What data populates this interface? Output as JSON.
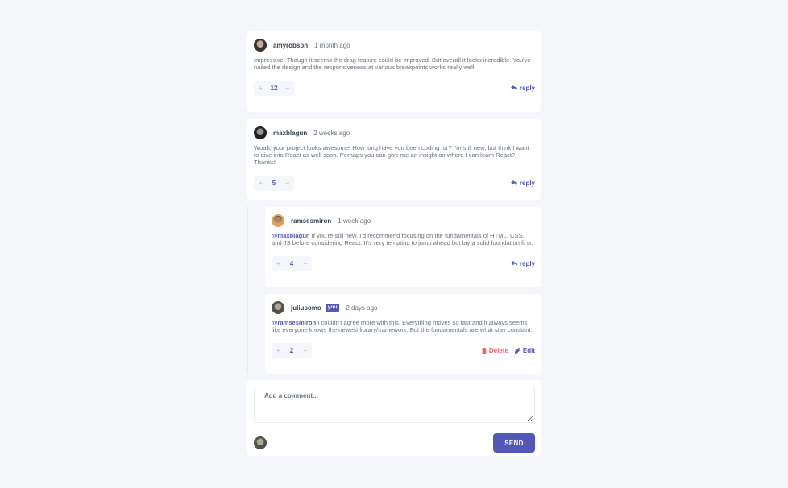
{
  "colors": {
    "primary": "#5357b6",
    "danger": "#ed6368",
    "page_bg": "#f5f6fa",
    "text_dark": "#334253",
    "text_muted": "#67727e"
  },
  "icons": {
    "reply": "reply-arrow-icon",
    "delete": "trash-icon",
    "edit": "pencil-icon",
    "upvote": "plus-icon",
    "downvote": "minus-icon"
  },
  "comments": [
    {
      "username": "amyrobson",
      "date": "1 month ago",
      "mention": "",
      "content": "Impressive! Though it seems the drag feature could be improved. But overall it looks incredible. You've nailed the design and the responsiveness at various breakpoints works really well.",
      "score": "12",
      "reply_label": "reply"
    },
    {
      "username": "maxblagun",
      "date": "2 weeks ago",
      "mention": "",
      "content": "Woah, your project looks awesome! How long have you been coding for? I'm still new, but think I want to dive into React as well soon. Perhaps you can give me an insight on where I can learn React? Thanks!",
      "score": "5",
      "reply_label": "reply",
      "replies": [
        {
          "username": "ramsesmiron",
          "date": "1 week ago",
          "mention": "@maxblagun",
          "content": " If you're still new, I'd recommend focusing on the fundamentals of HTML, CSS, and JS before considering React. It's very tempting to jump ahead but lay a solid foundation first.",
          "score": "4",
          "reply_label": "reply"
        },
        {
          "username": "juliusomo",
          "you_badge": "you",
          "date": "2 days ago",
          "mention": "@ramsesmiron",
          "content": " I couldn't agree more with this. Everything moves so fast and it always seems like everyone knows the newest library/framework. But the fundamentals are what stay constant.",
          "score": "2",
          "delete_label": "Delete",
          "edit_label": "Edit"
        }
      ]
    }
  ],
  "composer": {
    "placeholder": "Add a comment...",
    "send_label": "SEND"
  }
}
